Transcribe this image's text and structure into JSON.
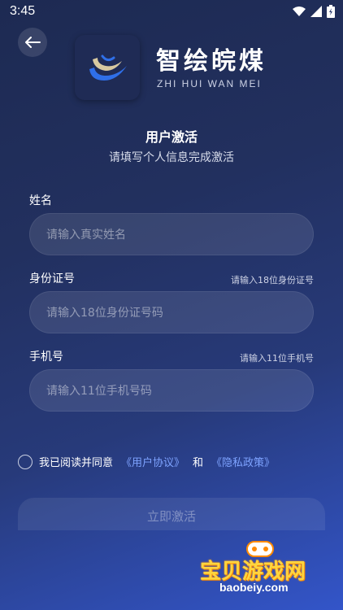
{
  "status_bar": {
    "time": "3:45"
  },
  "header": {
    "brand_name": "智绘皖煤",
    "brand_sub": "ZHI HUI WAN MEI"
  },
  "page": {
    "title": "用户激活",
    "subtitle": "请填写个人信息完成激活"
  },
  "form": {
    "name": {
      "label": "姓名",
      "placeholder": "请输入真实姓名"
    },
    "id_card": {
      "label": "身份证号",
      "hint": "请输入18位身份证号",
      "placeholder": "请输入18位身份证号码"
    },
    "phone": {
      "label": "手机号",
      "hint": "请输入11位手机号",
      "placeholder": "请输入11位手机号码"
    }
  },
  "agreement": {
    "prefix": "我已阅读并同意",
    "user_agreement": "《用户协议》",
    "and": "和",
    "privacy_policy": "《隐私政策》"
  },
  "submit": {
    "label": "立即激活"
  },
  "watermark": {
    "title": "宝贝游戏网",
    "url": "baobeiy.com"
  }
}
